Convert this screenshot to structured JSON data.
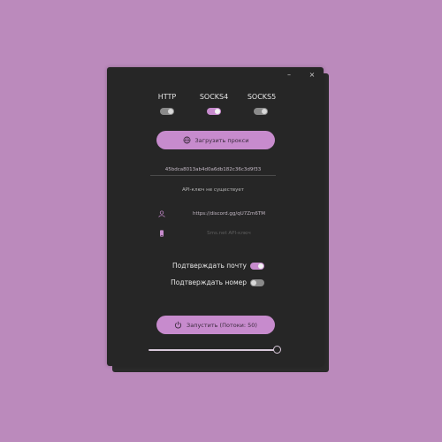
{
  "window": {
    "minimize_glyph": "–",
    "close_glyph": "×"
  },
  "protocols": [
    {
      "label": "HTTP",
      "enabled": false
    },
    {
      "label": "SOCKS4",
      "enabled": true
    },
    {
      "label": "SOCKS5",
      "enabled": false
    }
  ],
  "load_proxy_button": {
    "label": "Загрузить прокси",
    "icon": "globe-icon"
  },
  "api_key": {
    "value": "45bdca8013ab4d0a6db182c36c3d9f33"
  },
  "api_status": "API-ключ не существует",
  "discord": {
    "icon": "user-icon",
    "value": "https://discord.gg/qU7Zm6TM"
  },
  "sms": {
    "icon": "phone-icon",
    "placeholder": "Sms.net API-ключ"
  },
  "options": [
    {
      "label": "Подтверждать почту",
      "enabled": true
    },
    {
      "label": "Подтверждать номер",
      "enabled": false
    }
  ],
  "start_button": {
    "label": "Запустить (Потоки: 50)",
    "icon": "power-icon"
  },
  "threads_slider": {
    "value": 50,
    "max": 50
  },
  "colors": {
    "accent": "#c78bcd",
    "window_bg": "#262626",
    "page_bg": "#bb8abc"
  }
}
